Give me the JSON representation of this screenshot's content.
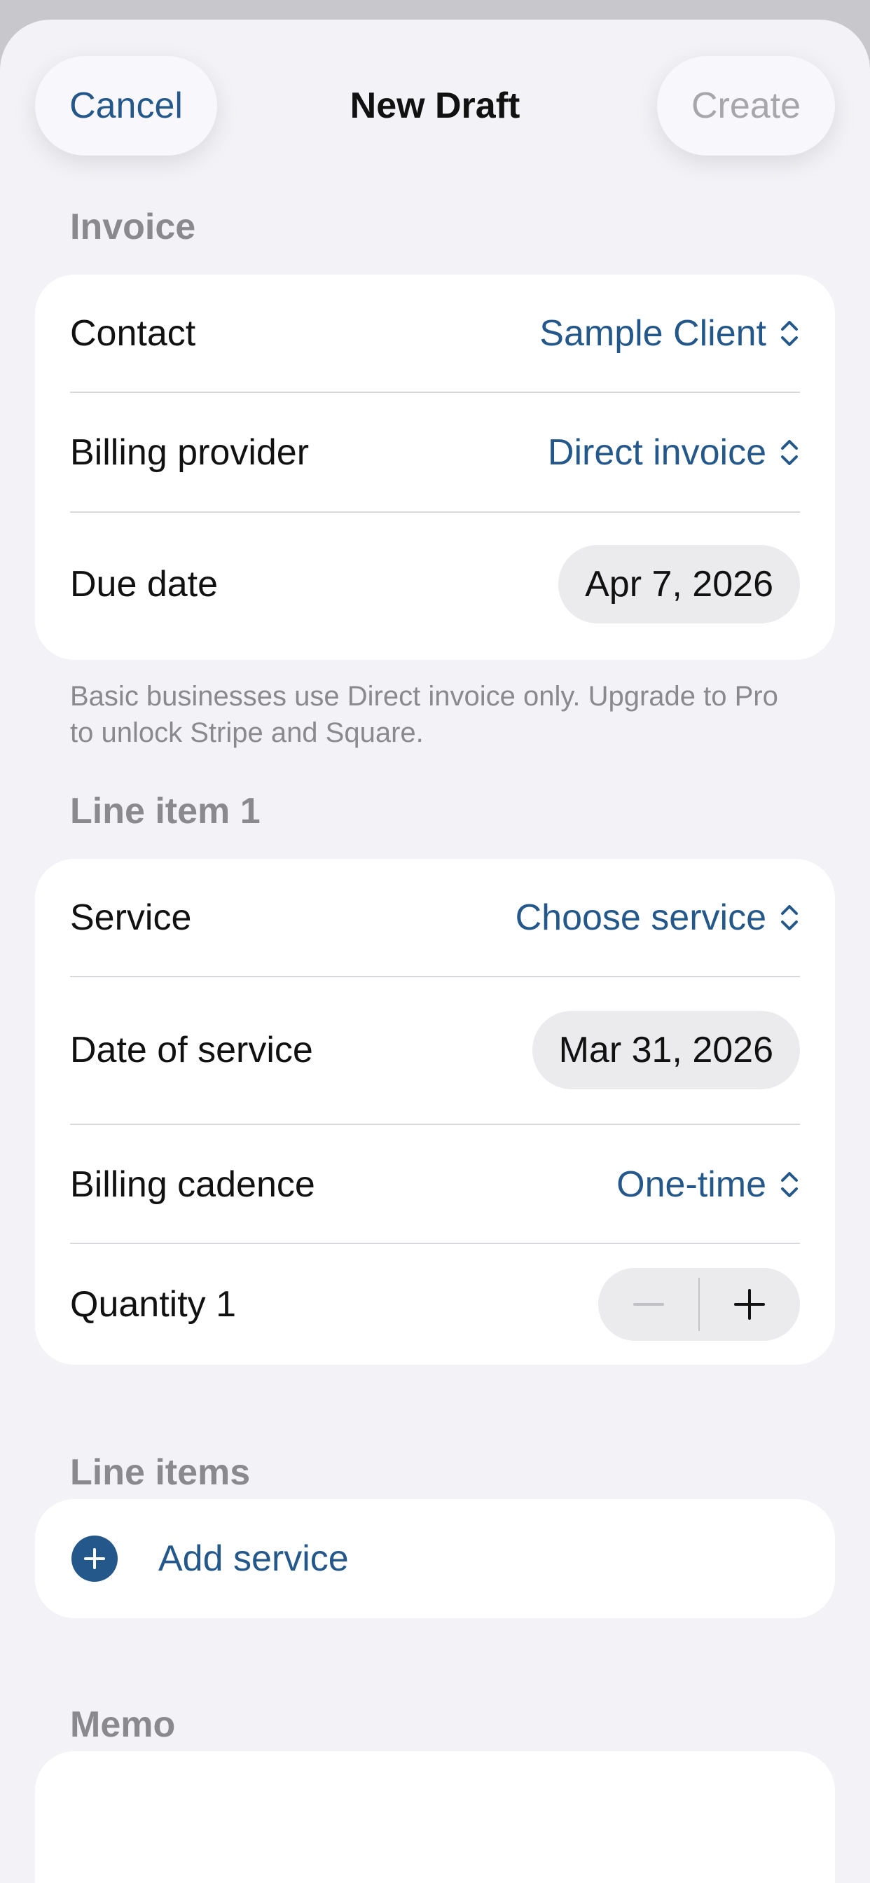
{
  "nav": {
    "cancel_label": "Cancel",
    "title": "New Draft",
    "create_label": "Create"
  },
  "invoice": {
    "header": "Invoice",
    "contact_label": "Contact",
    "contact_value": "Sample Client",
    "billing_provider_label": "Billing provider",
    "billing_provider_value": "Direct invoice",
    "due_date_label": "Due date",
    "due_date_value": "Apr 7, 2026",
    "footnote": "Basic businesses use Direct invoice only. Upgrade to Pro to unlock Stripe and Square."
  },
  "line_item": {
    "header": "Line item 1",
    "service_label": "Service",
    "service_value": "Choose service",
    "date_label": "Date of service",
    "date_value": "Mar 31, 2026",
    "cadence_label": "Billing cadence",
    "cadence_value": "One-time",
    "quantity_label": "Quantity 1"
  },
  "line_items": {
    "header": "Line items",
    "add_label": "Add service"
  },
  "memo": {
    "header": "Memo",
    "value": ""
  },
  "icons": {
    "picker": "chevron-up-down-icon",
    "decrement": "minus-icon",
    "increment": "plus-icon",
    "add": "plus-circle-icon"
  },
  "colors": {
    "accent": "#24588a",
    "background": "#f2f2f7",
    "card": "#ffffff",
    "disabled": "#a6a6ab",
    "secondary_text": "#8a8a8e"
  }
}
